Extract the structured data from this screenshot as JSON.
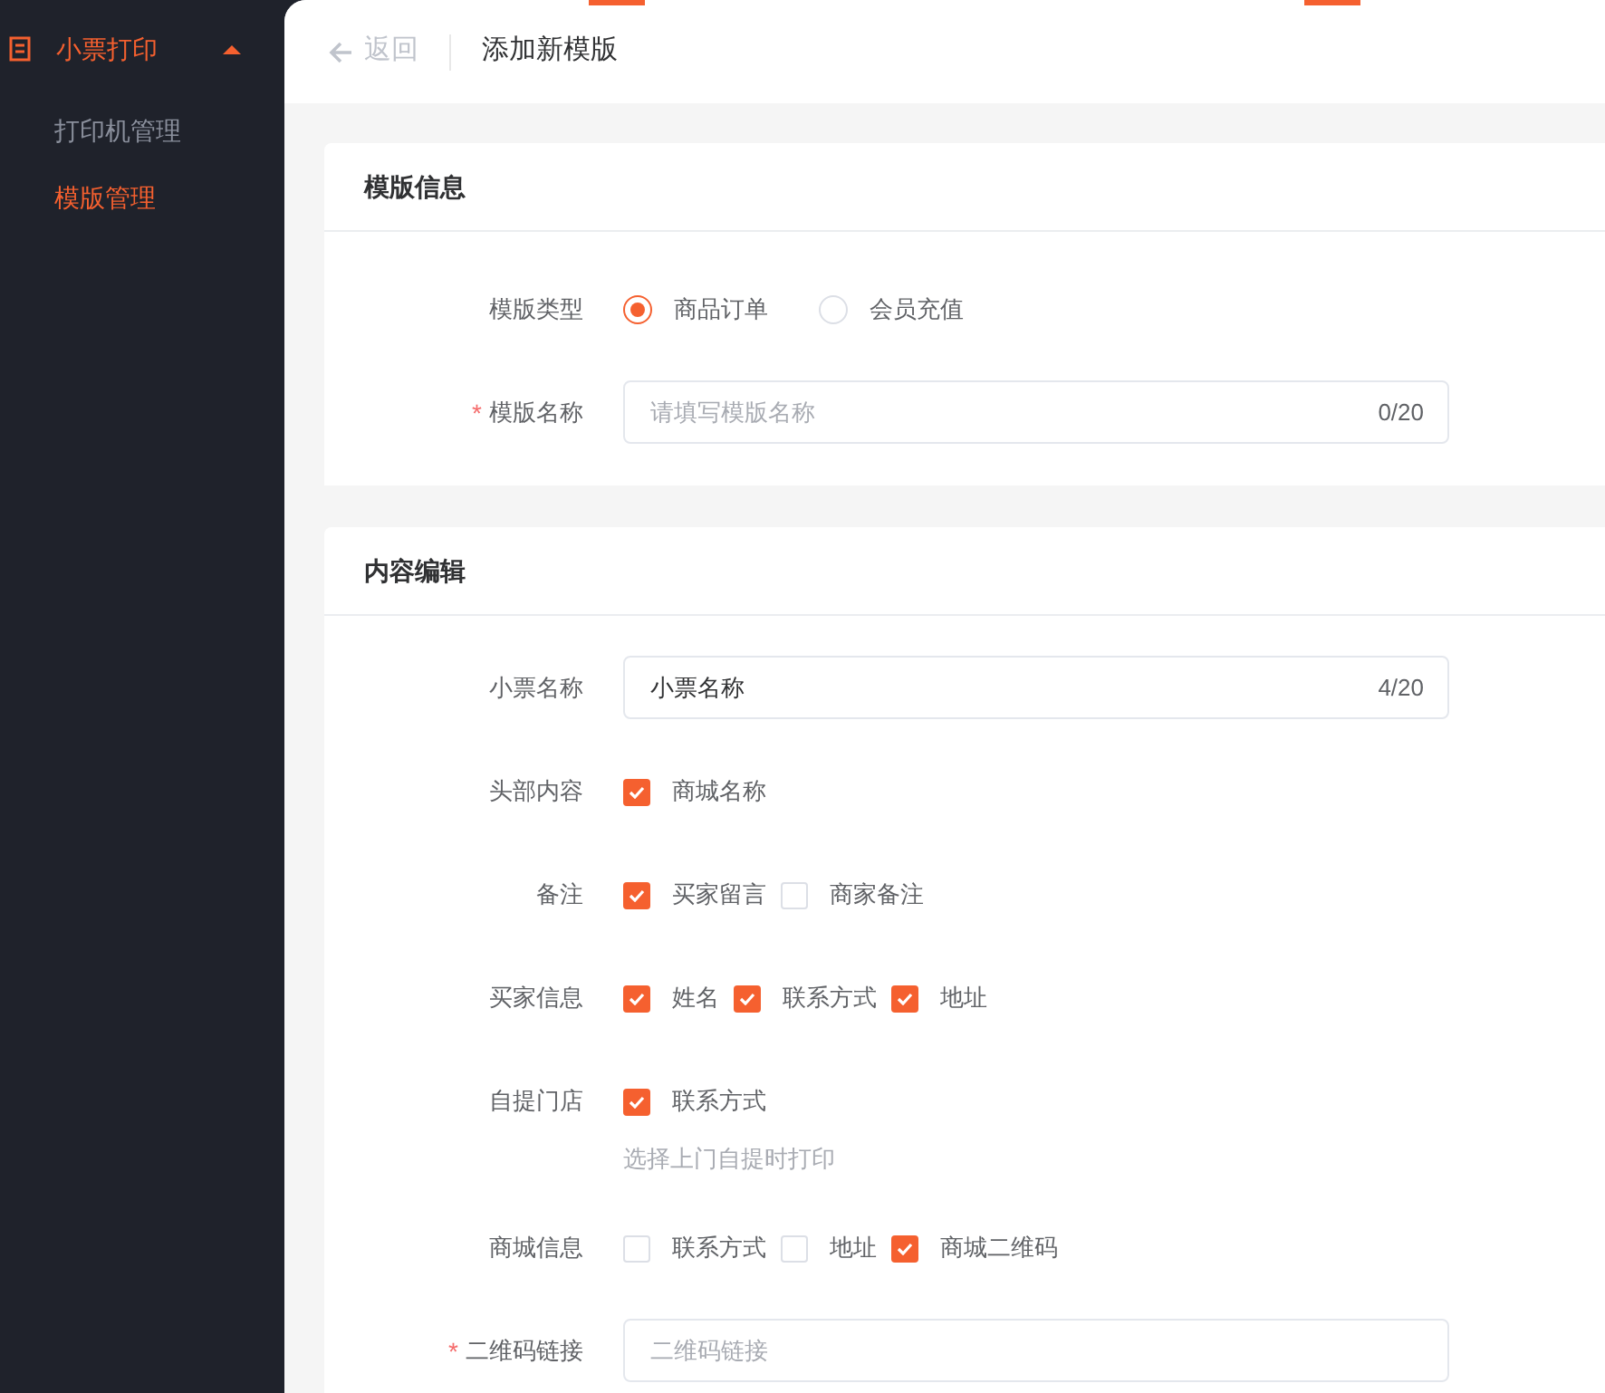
{
  "sidebar": {
    "group": {
      "label": "小票打印",
      "expanded": true
    },
    "items": [
      {
        "label": "打印机管理",
        "selected": false
      },
      {
        "label": "模版管理",
        "selected": true
      }
    ]
  },
  "header": {
    "back": "返回",
    "title": "添加新模版"
  },
  "sections": [
    {
      "title": "模版信息",
      "fields": [
        {
          "kind": "radio",
          "label": "模版类型",
          "options": [
            {
              "label": "商品订单",
              "selected": true
            },
            {
              "label": "会员充值",
              "selected": false
            }
          ]
        },
        {
          "kind": "text",
          "label": "模版名称",
          "required_mark": "*",
          "placeholder": "请填写模版名称",
          "counter": "0/20"
        }
      ]
    },
    {
      "title": "内容编辑",
      "fields": [
        {
          "kind": "text",
          "label": "小票名称",
          "value": "小票名称",
          "counter": "4/20"
        },
        {
          "kind": "checkbox",
          "label": "头部内容",
          "options": [
            {
              "label": "商城名称",
              "checked": true
            }
          ]
        },
        {
          "kind": "checkbox",
          "label": "备注",
          "options": [
            {
              "label": "买家留言",
              "checked": true
            },
            {
              "label": "商家备注",
              "checked": false
            }
          ]
        },
        {
          "kind": "checkbox",
          "label": "买家信息",
          "options": [
            {
              "label": "姓名",
              "checked": true
            },
            {
              "label": "联系方式",
              "checked": true
            },
            {
              "label": "地址",
              "checked": true
            }
          ]
        },
        {
          "kind": "checkbox",
          "label": "自提门店",
          "options": [
            {
              "label": "联系方式",
              "checked": true
            }
          ],
          "hint": "选择上门自提时打印"
        },
        {
          "kind": "checkbox",
          "label": "商城信息",
          "options": [
            {
              "label": "联系方式",
              "checked": false
            },
            {
              "label": "地址",
              "checked": false
            },
            {
              "label": "商城二维码",
              "checked": true
            }
          ]
        },
        {
          "kind": "text",
          "label": "二维码链接",
          "required_mark": "*",
          "placeholder": "二维码链接"
        }
      ]
    }
  ]
}
